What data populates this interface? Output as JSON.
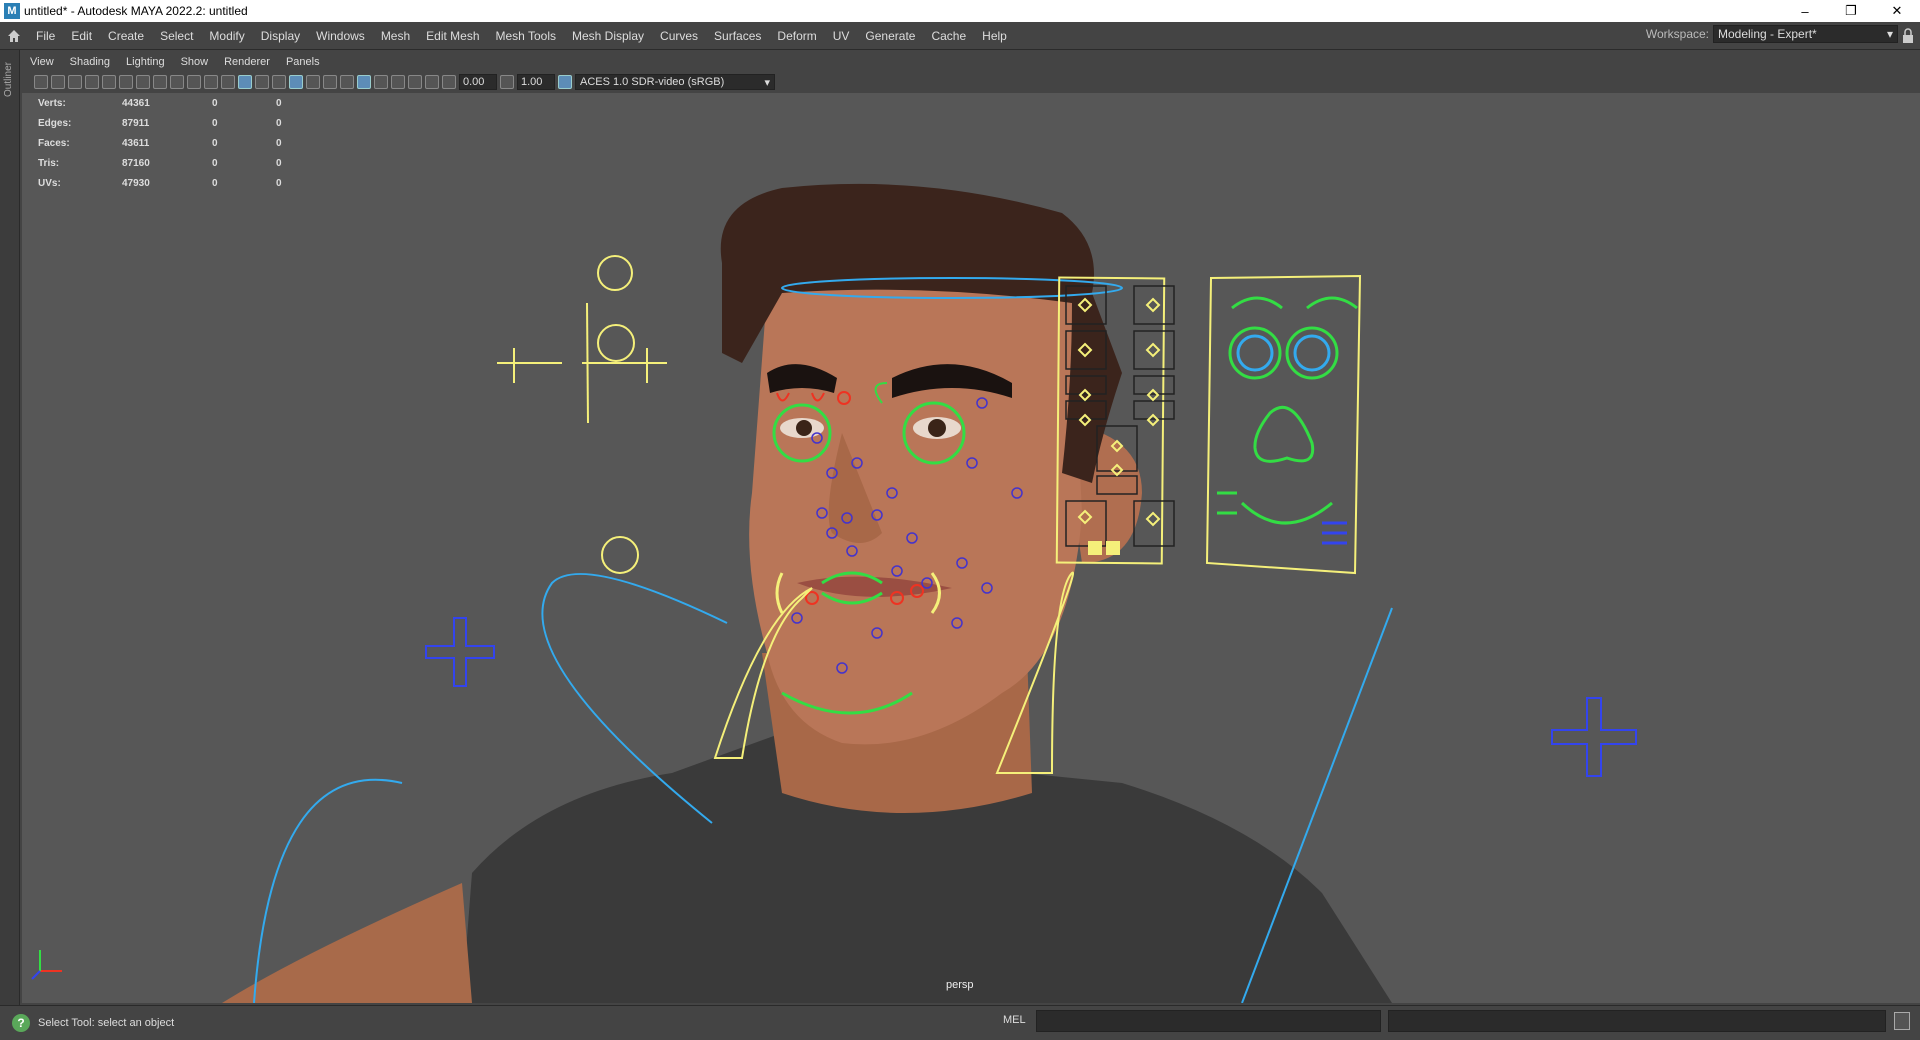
{
  "window": {
    "title": "untitled* - Autodesk MAYA 2022.2: untitled",
    "logo_letter": "M",
    "minimize": "–",
    "restore": "❐",
    "close": "✕"
  },
  "menubar": {
    "items": [
      "File",
      "Edit",
      "Create",
      "Select",
      "Modify",
      "Display",
      "Windows",
      "Mesh",
      "Edit Mesh",
      "Mesh Tools",
      "Mesh Display",
      "Curves",
      "Surfaces",
      "Deform",
      "UV",
      "Generate",
      "Cache",
      "Help"
    ],
    "workspace_label": "Workspace:",
    "workspace_value": "Modeling - Expert*"
  },
  "sidebar": {
    "outliner_label": "Outliner"
  },
  "panel_menu": [
    "View",
    "Shading",
    "Lighting",
    "Show",
    "Renderer",
    "Panels"
  ],
  "toolbar": {
    "exposure": "0.00",
    "gamma": "1.00",
    "color_space": "ACES 1.0 SDR-video (sRGB)"
  },
  "hud": {
    "rows": [
      {
        "label": "Verts:",
        "v1": "44361",
        "v2": "0",
        "v3": "0"
      },
      {
        "label": "Edges:",
        "v1": "87911",
        "v2": "0",
        "v3": "0"
      },
      {
        "label": "Faces:",
        "v1": "43611",
        "v2": "0",
        "v3": "0"
      },
      {
        "label": "Tris:",
        "v1": "87160",
        "v2": "0",
        "v3": "0"
      },
      {
        "label": "UVs:",
        "v1": "47930",
        "v2": "0",
        "v3": "0"
      }
    ]
  },
  "viewport": {
    "camera": "persp"
  },
  "statusbar": {
    "help_icon": "?",
    "message": "Select Tool: select an object",
    "mel_label": "MEL"
  },
  "colors": {
    "rig_yellow": "#f5f07a",
    "rig_green": "#33dd44",
    "rig_blue": "#3355ee",
    "rig_cyan": "#33aaee",
    "rig_red": "#ee3322",
    "skin": "#b57454",
    "hair": "#3b241c",
    "shirt": "#3a3a3a",
    "viewport_bg": "#575757"
  }
}
